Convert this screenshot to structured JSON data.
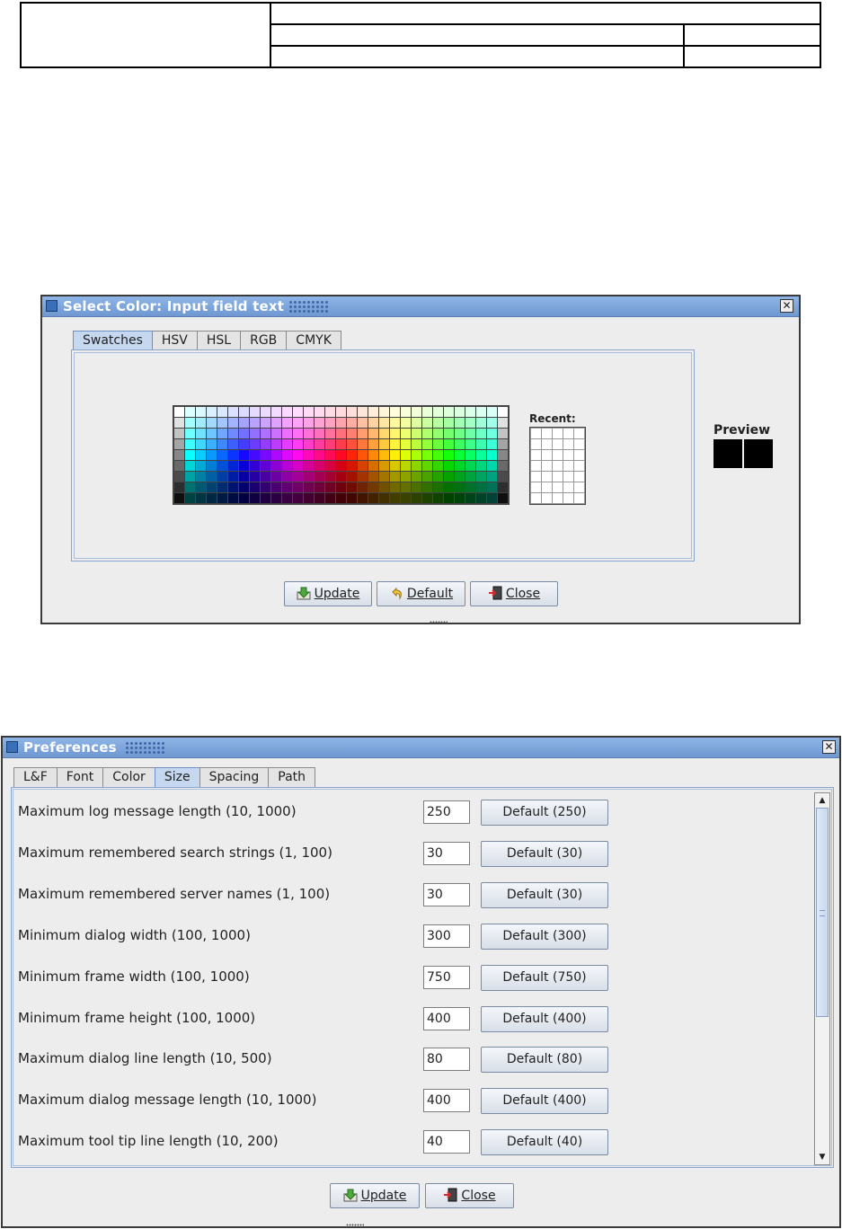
{
  "color_dialog": {
    "title": "Select Color: Input field text",
    "tabs": [
      "Swatches",
      "HSV",
      "HSL",
      "RGB",
      "CMYK"
    ],
    "selected_tab": "Swatches",
    "recent_label": "Recent:",
    "preview_label": "Preview",
    "preview_colors": [
      "#000000",
      "#000000"
    ],
    "buttons": {
      "update": "Update",
      "default": "Default",
      "close": "Close"
    }
  },
  "preferences": {
    "title": "Preferences",
    "tabs": [
      "L&F",
      "Font",
      "Color",
      "Size",
      "Spacing",
      "Path"
    ],
    "selected_tab": "Size",
    "rows": [
      {
        "label": "Maximum log message length (10, 1000)",
        "value": "250",
        "default_label": "Default (250)"
      },
      {
        "label": "Maximum remembered search strings (1, 100)",
        "value": "30",
        "default_label": "Default (30)"
      },
      {
        "label": "Maximum remembered server names (1, 100)",
        "value": "30",
        "default_label": "Default (30)"
      },
      {
        "label": "Minimum dialog width (100, 1000)",
        "value": "300",
        "default_label": "Default (300)"
      },
      {
        "label": "Minimum frame width (100, 1000)",
        "value": "750",
        "default_label": "Default (750)"
      },
      {
        "label": "Minimum frame height (100, 1000)",
        "value": "400",
        "default_label": "Default (400)"
      },
      {
        "label": "Maximum dialog line length (10, 500)",
        "value": "80",
        "default_label": "Default (80)"
      },
      {
        "label": "Maximum dialog message length (10, 1000)",
        "value": "400",
        "default_label": "Default (400)"
      },
      {
        "label": "Maximum tool tip line length (10, 200)",
        "value": "40",
        "default_label": "Default (40)"
      }
    ],
    "buttons": {
      "update": "Update",
      "close": "Close"
    }
  },
  "icons": [
    "close-icon",
    "window-icon",
    "update-icon",
    "default-undo-icon",
    "exit-door-icon",
    "scroll-up-icon",
    "scroll-down-icon"
  ]
}
